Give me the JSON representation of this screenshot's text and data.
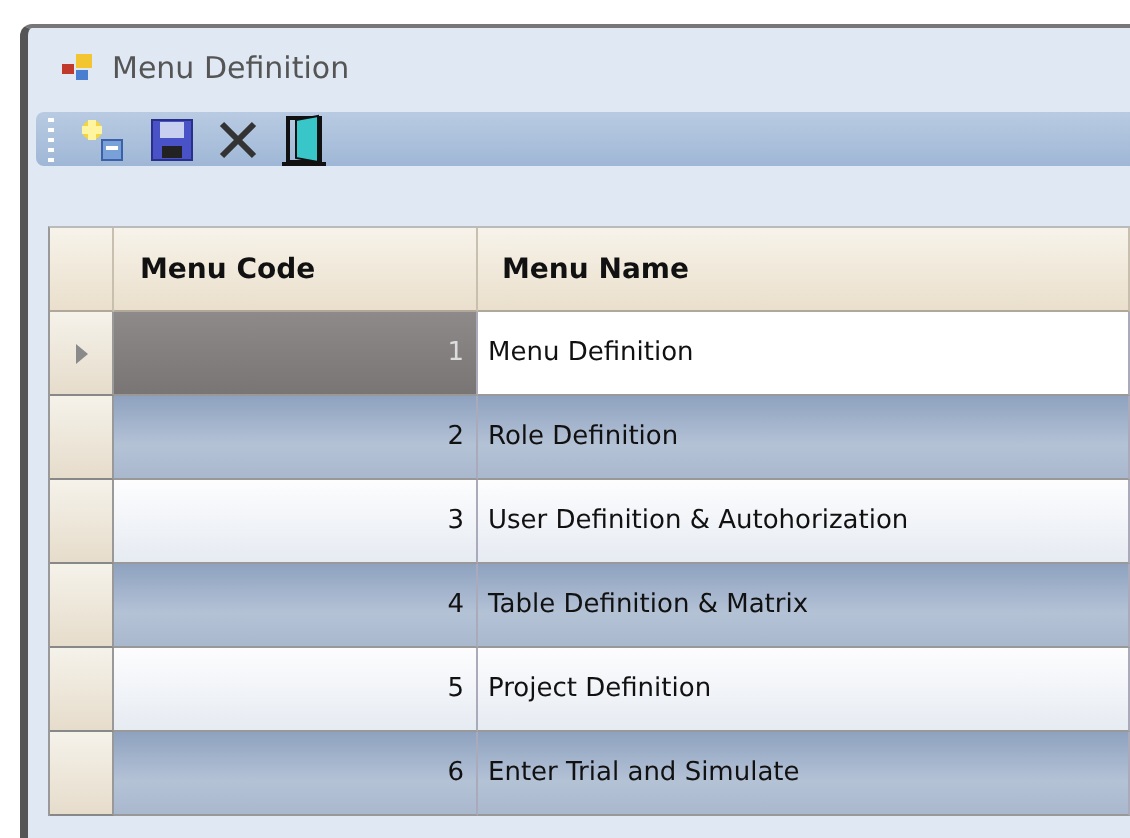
{
  "window": {
    "title": "Menu Definition"
  },
  "toolbar": {
    "buttons": [
      {
        "kind": "add"
      },
      {
        "kind": "save"
      },
      {
        "kind": "delete"
      },
      {
        "kind": "exit"
      }
    ]
  },
  "table": {
    "columns": [
      "Menu Code",
      "Menu Name"
    ],
    "rows": [
      {
        "code": "1",
        "name": "Menu Definition",
        "selected": true
      },
      {
        "code": "2",
        "name": "Role Definition",
        "selected": false
      },
      {
        "code": "3",
        "name": "User Definition & Autohorization",
        "selected": false
      },
      {
        "code": "4",
        "name": "Table Definition & Matrix",
        "selected": false
      },
      {
        "code": "5",
        "name": "Project Definition",
        "selected": false
      },
      {
        "code": "6",
        "name": "Enter Trial and Simulate",
        "selected": false
      }
    ]
  }
}
